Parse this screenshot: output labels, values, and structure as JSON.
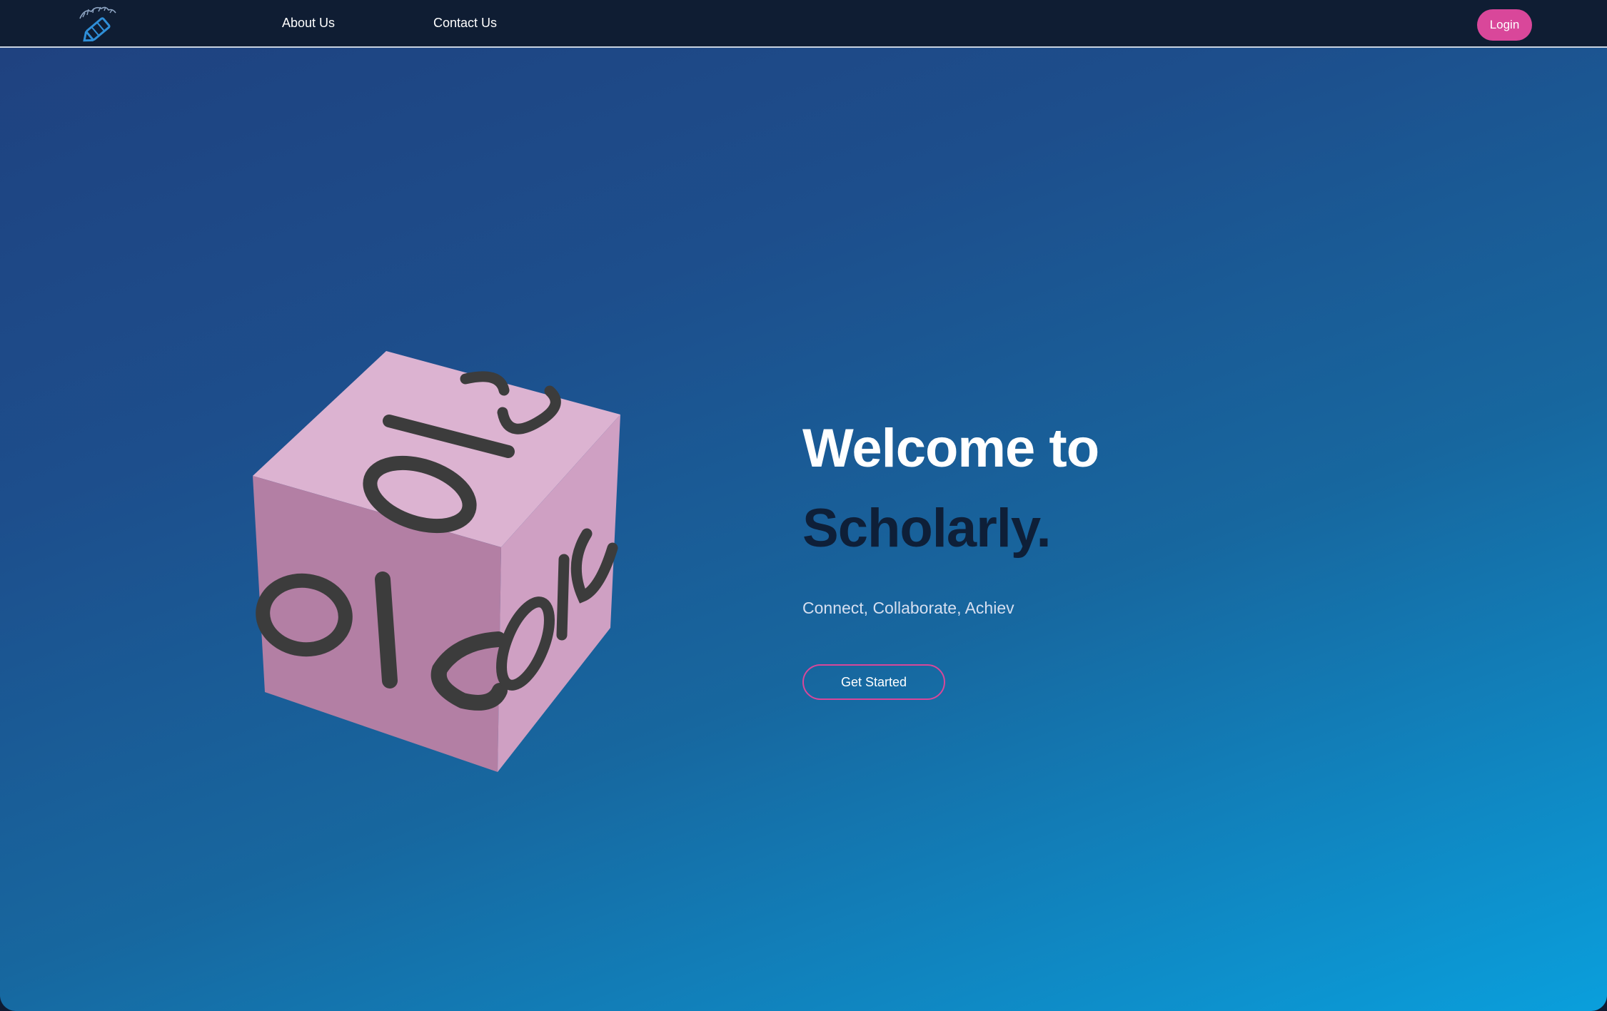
{
  "nav": {
    "logo_icon": "scholarly-pencil-logo",
    "links": [
      {
        "label": "About Us"
      },
      {
        "label": "Contact Us"
      }
    ],
    "login_label": "Login"
  },
  "hero": {
    "headline_line1": "Welcome to",
    "headline_line2": "Scholarly.",
    "tagline": "Connect, Collaborate, Achiev",
    "cta_label": "Get Started",
    "cube_icon": "rotating-3d-cube"
  },
  "colors": {
    "nav_bg": "#0f1d33",
    "accent_pink": "#d9479a",
    "hero_gradient_start": "#1f4280",
    "hero_gradient_end": "#0a9fdc",
    "cube_face": "#dcb3d1",
    "headline_dark": "#0e1f38"
  }
}
